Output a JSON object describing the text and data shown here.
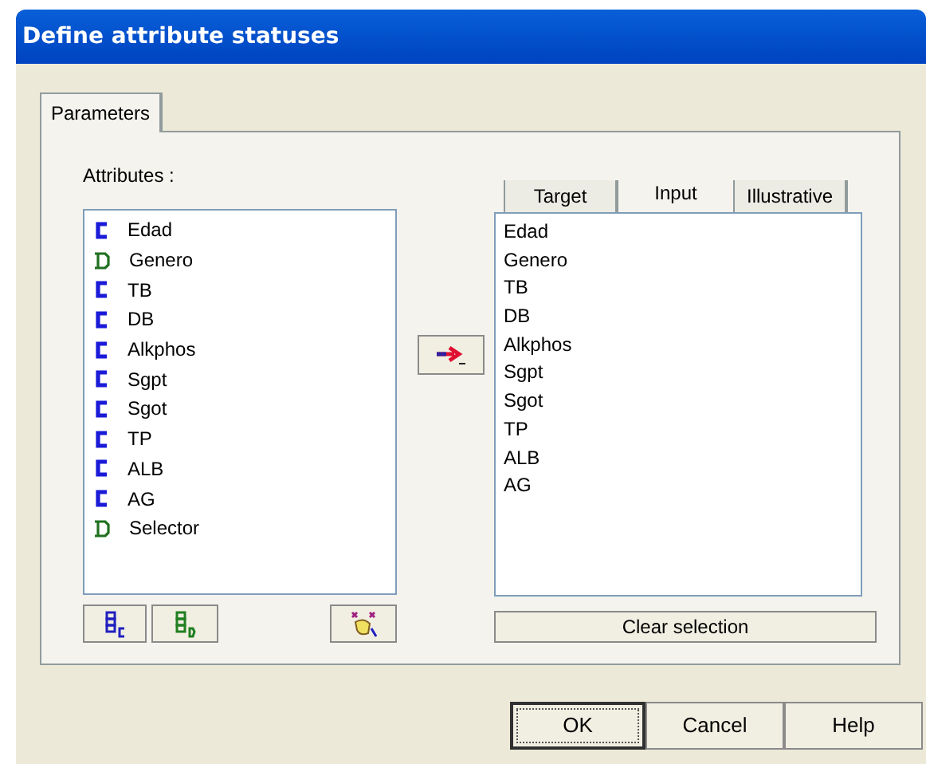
{
  "window": {
    "title": "Define attribute statuses"
  },
  "tabs": [
    {
      "label": "Parameters",
      "selected": true
    }
  ],
  "attributes": {
    "label": "Attributes :",
    "items": [
      {
        "name": "Edad",
        "kind": "continuous"
      },
      {
        "name": "Genero",
        "kind": "discrete"
      },
      {
        "name": "TB",
        "kind": "continuous"
      },
      {
        "name": "DB",
        "kind": "continuous"
      },
      {
        "name": "Alkphos",
        "kind": "continuous"
      },
      {
        "name": "Sgpt",
        "kind": "continuous"
      },
      {
        "name": "Sgot",
        "kind": "continuous"
      },
      {
        "name": "TP",
        "kind": "continuous"
      },
      {
        "name": "ALB",
        "kind": "continuous"
      },
      {
        "name": "AG",
        "kind": "continuous"
      },
      {
        "name": "Selector",
        "kind": "discrete"
      }
    ]
  },
  "status_tabs": [
    {
      "label": "Target",
      "selected": false
    },
    {
      "label": "Input",
      "selected": true
    },
    {
      "label": "Illustrative",
      "selected": false
    }
  ],
  "selected_list": [
    "Edad",
    "Genero",
    "TB",
    "DB",
    "Alkphos",
    "Sgpt",
    "Sgot",
    "TP",
    "ALB",
    "AG"
  ],
  "clear_button": "Clear selection",
  "buttons": [
    {
      "label": "OK",
      "default": true
    },
    {
      "label": "Cancel",
      "default": false
    },
    {
      "label": "Help",
      "default": false
    }
  ]
}
